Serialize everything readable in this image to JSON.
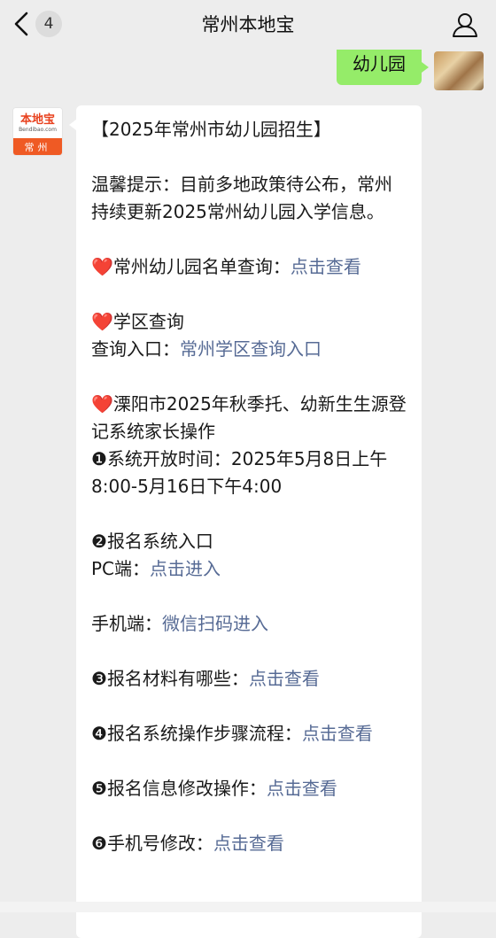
{
  "header": {
    "title": "常州本地宝",
    "unread_count": "4"
  },
  "sent_message": {
    "text": "幼儿园"
  },
  "bot": {
    "logo_main": "本地宝",
    "logo_sub": "Bendibao.com",
    "logo_city": "常州"
  },
  "message": {
    "headline": "【2025年常州市幼儿园招生】",
    "tip": "温馨提示：目前多地政策待公布，常州持续更新2025常州幼儿园入学信息。",
    "heart": "❤️",
    "list_query_label": "常州幼儿园名单查询：",
    "list_query_link": "点击查看",
    "district_title": "学区查询",
    "district_entry_label": "查询入口：",
    "district_entry_link": "常州学区查询入口",
    "liyang_title": "溧阳市2025年秋季托、幼新生生源登记系统家长操作",
    "item1_marker": "❶",
    "item1_text": "系统开放时间：2025年5月8日上午8:00-5月16日下午4:00",
    "item2_marker": "❷",
    "item2_text": "报名系统入口",
    "pc_label": "PC端：",
    "pc_link": "点击进入",
    "mobile_label": "手机端：",
    "mobile_link": "微信扫码进入",
    "item3_marker": "❸",
    "item3_text": "报名材料有哪些：",
    "item3_link": "点击查看",
    "item4_marker": "❹",
    "item4_text": "报名系统操作步骤流程：",
    "item4_link": "点击查看",
    "item5_marker": "❺",
    "item5_text": "报名信息修改操作：",
    "item5_link": "点击查看",
    "item6_marker": "❻",
    "item6_text": "手机号修改：",
    "item6_link": "点击查看"
  },
  "colors": {
    "link": "#576b95",
    "sent_bubble": "#95ec69",
    "brand": "#ef5a24"
  }
}
